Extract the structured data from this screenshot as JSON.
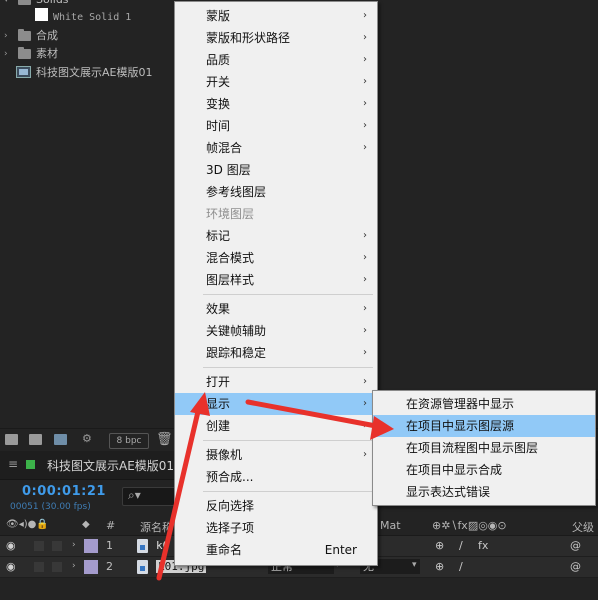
{
  "project": {
    "rows": [
      {
        "name": "Solids",
        "kind": "folder-open"
      },
      {
        "name": "White Solid 1",
        "kind": "solid"
      },
      {
        "name": "合成",
        "kind": "folder"
      },
      {
        "name": "素材",
        "kind": "folder"
      },
      {
        "name": "科技图文展示AE模版01",
        "kind": "composition"
      }
    ],
    "toolbar": {
      "bit_depth": "8 bpc"
    }
  },
  "timeline": {
    "tab_title": "科技图文展示AE模版01",
    "timecode": "0:00:01:21",
    "fps_label": "00051 (30.00 fps)",
    "search_glyph": "⌕▾",
    "headers": {
      "num": "#",
      "source_name": "源名称",
      "track_matte": "Mat",
      "parent": "父级"
    },
    "layers": [
      {
        "num": "1",
        "name": "k0",
        "mode": "",
        "matte": ""
      },
      {
        "num": "2",
        "name": "k01.jpg",
        "mode": "正常",
        "matte": "无"
      }
    ]
  },
  "context_menu": {
    "items": [
      {
        "label": "蒙版",
        "submenu": true
      },
      {
        "label": "蒙版和形状路径",
        "submenu": true
      },
      {
        "label": "品质",
        "submenu": true
      },
      {
        "label": "开关",
        "submenu": true
      },
      {
        "label": "变换",
        "submenu": true
      },
      {
        "label": "时间",
        "submenu": true
      },
      {
        "label": "帧混合",
        "submenu": true
      },
      {
        "label": "3D 图层",
        "submenu": false
      },
      {
        "label": "参考线图层",
        "submenu": false
      },
      {
        "label": "环境图层",
        "submenu": false,
        "disabled": true
      },
      {
        "label": "标记",
        "submenu": true
      },
      {
        "label": "混合模式",
        "submenu": true
      },
      {
        "label": "图层样式",
        "submenu": true
      },
      {
        "label": "效果",
        "submenu": true
      },
      {
        "label": "关键帧辅助",
        "submenu": true
      },
      {
        "label": "跟踪和稳定",
        "submenu": true
      },
      {
        "label": "打开",
        "submenu": true
      },
      {
        "label": "显示",
        "submenu": true,
        "highlighted": true
      },
      {
        "label": "创建",
        "submenu": true
      },
      {
        "label": "摄像机",
        "submenu": true
      },
      {
        "label": "预合成...",
        "submenu": false
      },
      {
        "label": "反向选择",
        "submenu": false
      },
      {
        "label": "选择子项",
        "submenu": false
      },
      {
        "label": "重命名",
        "submenu": false,
        "shortcut": "Enter"
      }
    ],
    "submenu_glyph": "›"
  },
  "reveal_submenu": {
    "items": [
      {
        "label": "在资源管理器中显示"
      },
      {
        "label": "在项目中显示图层源",
        "highlighted": true
      },
      {
        "label": "在项目流程图中显示图层"
      },
      {
        "label": "在项目中显示合成"
      },
      {
        "label": "显示表达式错误"
      }
    ]
  },
  "colors": {
    "menu_background": "#f0f0f0",
    "menu_highlight": "#91c9f7",
    "timecode_blue": "#3f9bea",
    "annotation_red": "#e8312b",
    "label_lavender": "#a49bcc",
    "comp_green": "#3cb24a"
  }
}
